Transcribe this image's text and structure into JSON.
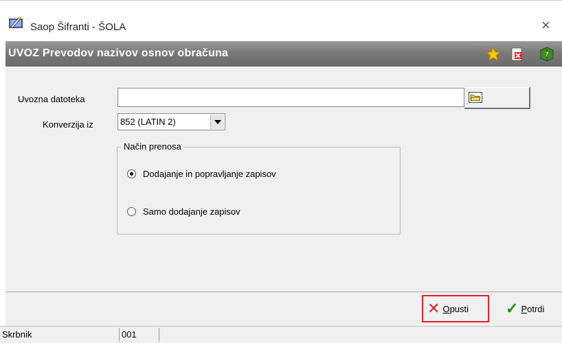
{
  "window": {
    "title": "Saop Šifranti - ŠOLA"
  },
  "header": {
    "title": "UVOZ Prevodov nazivov osnov obračuna"
  },
  "form": {
    "file_label": "Uvozna datoteka",
    "file_value": "",
    "conversion_label": "Konverzija iz",
    "conversion_value": "852 (LATIN 2)",
    "transfer_group_title": "Način prenosa",
    "options": [
      {
        "label": "Dodajanje in popravljanje zapisov",
        "checked": true
      },
      {
        "label": "Samo dodajanje zapisov",
        "checked": false
      }
    ]
  },
  "footer": {
    "cancel_prefix": "",
    "cancel_key": "O",
    "cancel_rest": "pusti",
    "confirm_key": "P",
    "confirm_rest": "otrdi"
  },
  "status": {
    "user": "Skrbnik",
    "code": "001",
    "extra": ""
  },
  "icons": {
    "app": "app-wand-icon",
    "close": "close-icon",
    "star": "star-icon",
    "delete": "delete-icon",
    "book": "help-book-icon",
    "browse": "folder-icon",
    "cancel": "x-icon",
    "confirm": "checkmark-icon"
  },
  "colors": {
    "header_bg": "#7a7a7a",
    "cancel_highlight": "#e0202a",
    "check": "#1a8a1a",
    "x": "#dd2222"
  }
}
